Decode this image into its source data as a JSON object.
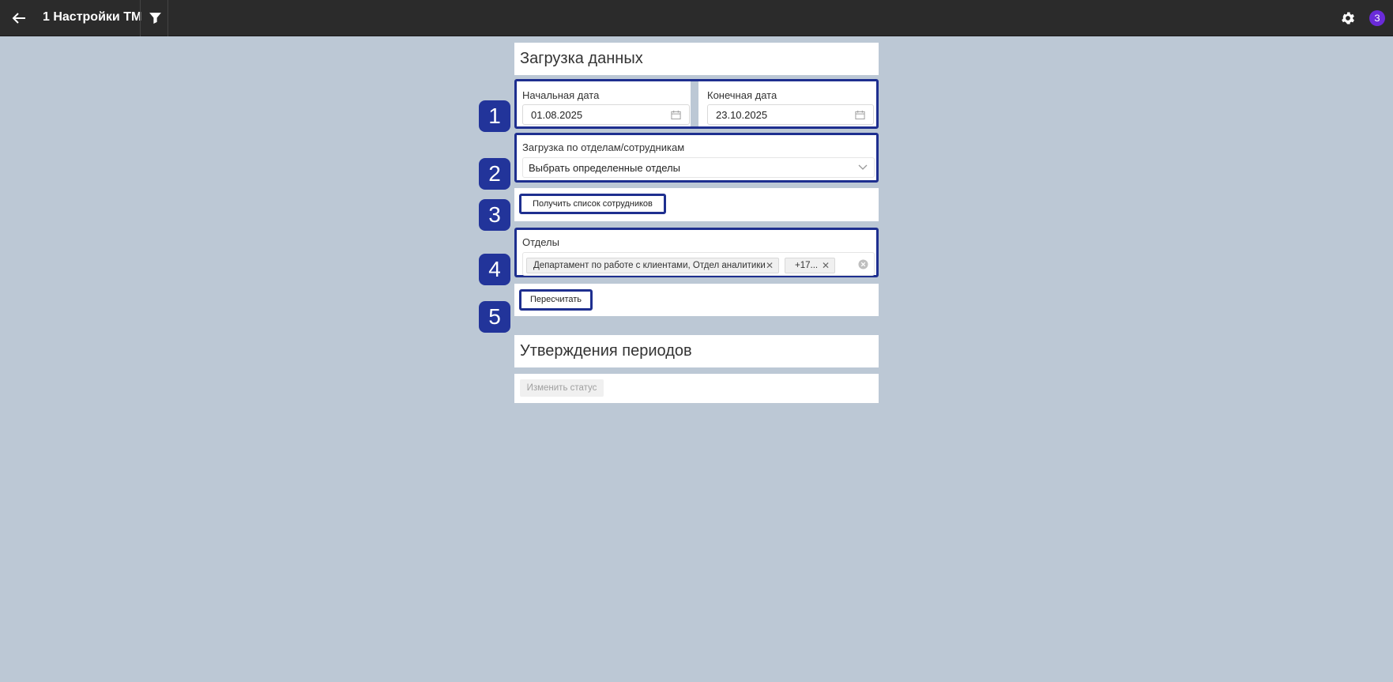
{
  "topbar": {
    "title": "1 Настройки ТМ",
    "back_icon": "arrow-left-icon",
    "filter_icon": "filter-icon",
    "settings_icon": "gear-icon",
    "avatar_letter": "З",
    "avatar_color": "#6a2bd9",
    "background": "#2b2b2b"
  },
  "load_section": {
    "title": "Загрузка данных",
    "start_date": {
      "label": "Начальная дата",
      "value": "01.08.2025",
      "icon": "calendar-icon"
    },
    "end_date": {
      "label": "Конечная дата",
      "value": "23.10.2025",
      "icon": "calendar-icon"
    },
    "mode": {
      "label": "Загрузка по отделам/сотрудникам",
      "value": "Выбрать определенные отделы",
      "icon": "chevron-down-icon"
    },
    "get_employees_button": "Получить список сотрудников",
    "departments": {
      "label": "Отделы",
      "tags": [
        "Департамент по работе с клиентами, Отдел аналитики",
        "+17..."
      ],
      "clear_icon": "clear-circle-icon"
    },
    "recalc_button": "Пересчитать"
  },
  "approval_section": {
    "title": "Утверждения периодов",
    "change_status_button": "Изменить статус"
  },
  "badges": [
    "1",
    "2",
    "3",
    "4",
    "5"
  ],
  "colors": {
    "highlight": "#1e2f8f",
    "badge": "#22349a",
    "page_bg": "#bcc8d5"
  }
}
